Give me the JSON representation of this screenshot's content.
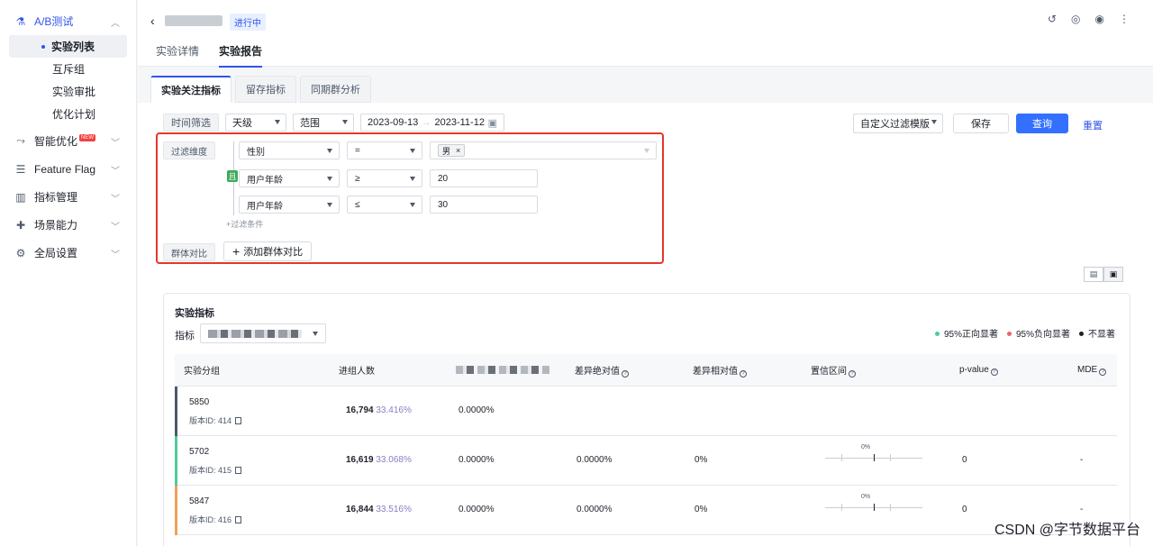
{
  "sidebar": {
    "items": [
      {
        "label": "A/B测试",
        "icon": "flask-icon",
        "glyph": "⚗",
        "active": true
      },
      {
        "label": "智能优化",
        "icon": "branch-icon",
        "glyph": "⤳",
        "badge": "NEW"
      },
      {
        "label": "Feature Flag",
        "icon": "flag-list-icon",
        "glyph": "☰"
      },
      {
        "label": "指标管理",
        "icon": "bar-chart-icon",
        "glyph": "▥"
      },
      {
        "label": "场景能力",
        "icon": "puzzle-icon",
        "glyph": "✚"
      },
      {
        "label": "全局设置",
        "icon": "gear-icon",
        "glyph": "⚙"
      }
    ],
    "sub_items": [
      "实验列表",
      "互斥组",
      "实验审批",
      "优化计划"
    ]
  },
  "header": {
    "status": "进行中",
    "tabs": [
      "实验详情",
      "实验报告"
    ]
  },
  "sub_tabs": [
    "实验关注指标",
    "留存指标",
    "同期群分析"
  ],
  "filters": {
    "time_label": "时间筛选",
    "granularity": "天级",
    "range_label": "范围",
    "start_date": "2023-09-13",
    "end_date": "2023-11-12",
    "date_arrow": "→",
    "template": "自定义过滤模版",
    "save": "保存",
    "query": "查询",
    "reset": "重置",
    "dimension_label": "过滤维度",
    "and_label": "且",
    "conditions": [
      {
        "field": "性别",
        "op": "=",
        "value": "男"
      },
      {
        "field": "用户年龄",
        "op": "≥",
        "value": "20"
      },
      {
        "field": "用户年龄",
        "op": "≤",
        "value": "30"
      }
    ],
    "add_condition": "+过滤条件",
    "group_compare_label": "群体对比",
    "add_group": "添加群体对比"
  },
  "metrics": {
    "title": "实验指标",
    "metric_label": "指标",
    "legend": [
      {
        "label": "95%正向显著",
        "color": "#4ecb9b"
      },
      {
        "label": "95%负向显著",
        "color": "#e86473"
      },
      {
        "label": "不显著",
        "color": "#1d2129"
      }
    ],
    "columns": [
      "实验分组",
      "进组人数",
      "差异绝对值",
      "差异相对值",
      "置信区间",
      "p-value",
      "MDE"
    ],
    "rows": [
      {
        "group": "5850",
        "version": "版本ID: 414",
        "users": "16,794",
        "share": "33.416%",
        "value": "0.0000%",
        "abs": "",
        "rel": "",
        "ci": "",
        "p": "",
        "mde": "",
        "color": "#4e5969"
      },
      {
        "group": "5702",
        "version": "版本ID: 415",
        "users": "16,619",
        "share": "33.068%",
        "value": "0.0000%",
        "abs": "0.0000%",
        "rel": "0%",
        "ci": "0%",
        "p": "0",
        "mde": "-",
        "color": "#4ecb9b"
      },
      {
        "group": "5847",
        "version": "版本ID: 416",
        "users": "16,844",
        "share": "33.516%",
        "value": "0.0000%",
        "abs": "0.0000%",
        "rel": "0%",
        "ci": "0%",
        "p": "0",
        "mde": "-",
        "color": "#f0a05a"
      }
    ]
  },
  "watermark": "CSDN @字节数据平台"
}
